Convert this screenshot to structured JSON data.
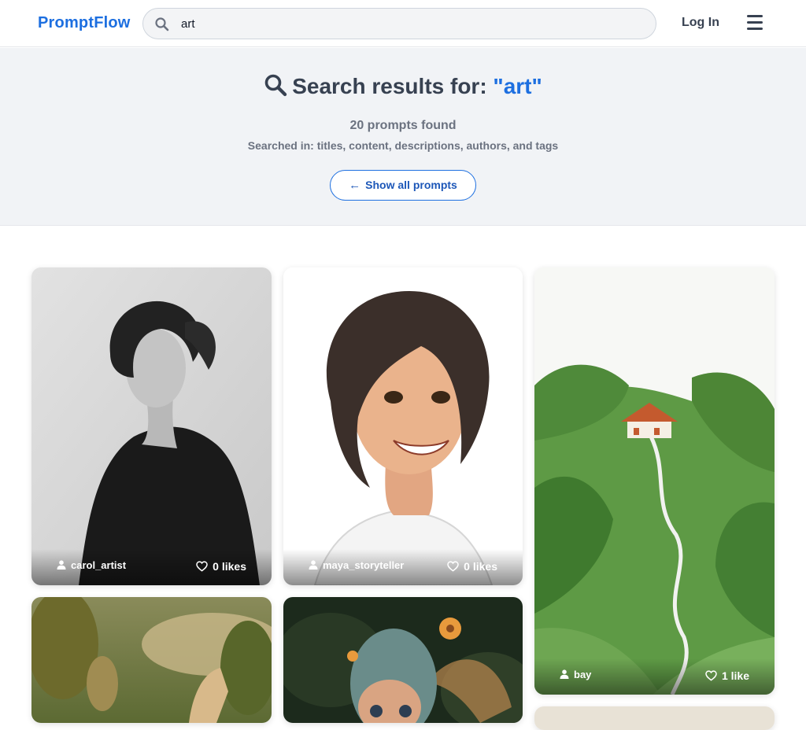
{
  "header": {
    "logo": "PromptFlow",
    "search_value": "art",
    "login_label": "Log In"
  },
  "results": {
    "title_prefix": "Search results for:",
    "query_display": "\"art\"",
    "count_text": "20 prompts found",
    "searched_in_text": "Searched in: titles, content, descriptions, authors, and tags",
    "show_all_label": "Show all prompts"
  },
  "cards": [
    {
      "author": "carol_artist",
      "likes": "0 likes"
    },
    {
      "author": "maya_storyteller",
      "likes": "0 likes"
    },
    {
      "author": "bay",
      "likes": "1 like"
    }
  ],
  "colors": {
    "accent": "#1d6fe0",
    "hero_bg": "#f1f3f6"
  }
}
